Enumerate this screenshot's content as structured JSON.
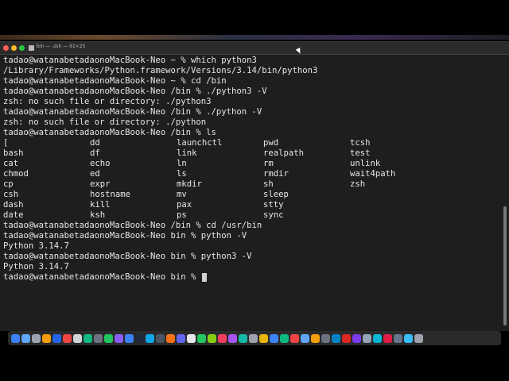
{
  "window": {
    "title": "bin — -zsh — 91×25"
  },
  "terminal": {
    "lines": [
      "tadao@watanabetadaonoMacBook-Neo ~ % which python3",
      "/Library/Frameworks/Python.framework/Versions/3.14/bin/python3",
      "tadao@watanabetadaonoMacBook-Neo ~ % cd /bin",
      "tadao@watanabetadaonoMacBook-Neo /bin % ./python3 -V",
      "zsh: no such file or directory: ./python3",
      "tadao@watanabetadaonoMacBook-Neo /bin % ./python -V",
      "zsh: no such file or directory: ./python",
      "tadao@watanabetadaonoMacBook-Neo /bin % ls"
    ],
    "ls_rows": [
      [
        "[",
        "dd",
        "launchctl",
        "pwd",
        "tcsh"
      ],
      [
        "bash",
        "df",
        "link",
        "realpath",
        "test"
      ],
      [
        "cat",
        "echo",
        "ln",
        "rm",
        "unlink"
      ],
      [
        "chmod",
        "ed",
        "ls",
        "rmdir",
        "wait4path"
      ],
      [
        "cp",
        "expr",
        "mkdir",
        "sh",
        "zsh"
      ],
      [
        "csh",
        "hostname",
        "mv",
        "sleep",
        ""
      ],
      [
        "dash",
        "kill",
        "pax",
        "stty",
        ""
      ],
      [
        "date",
        "ksh",
        "ps",
        "sync",
        ""
      ]
    ],
    "after_lines": [
      "tadao@watanabetadaonoMacBook-Neo /bin % cd /usr/bin",
      "tadao@watanabetadaonoMacBook-Neo bin % python -V",
      "Python 3.14.7",
      "tadao@watanabetadaonoMacBook-Neo bin % python3 -V",
      "Python 3.14.7"
    ],
    "current_prompt": "tadao@watanabetadaonoMacBook-Neo bin % "
  },
  "dock": {
    "icon_colors": [
      "#3b82f6",
      "#60a5fa",
      "#9ca3af",
      "#f59e0b",
      "#2563eb",
      "#ef4444",
      "#d1d5db",
      "#10b981",
      "#6b7280",
      "#22c55e",
      "#8b5cf6",
      "#3b82f6",
      "#1f2937",
      "#0ea5e9",
      "#4b5563",
      "#f97316",
      "#6366f1",
      "#e5e7eb",
      "#22c55e",
      "#84cc16",
      "#f43f5e",
      "#a855f7",
      "#14b8a6",
      "#9ca3af",
      "#eab308",
      "#3b82f6",
      "#10b981",
      "#ef4444",
      "#60a5fa",
      "#f59e0b",
      "#6b7280",
      "#0284c7",
      "#dc2626",
      "#7c3aed",
      "#94a3b8",
      "#06b6d4",
      "#e11d48",
      "#64748b",
      "#38bdf8",
      "#9ca3af"
    ]
  }
}
